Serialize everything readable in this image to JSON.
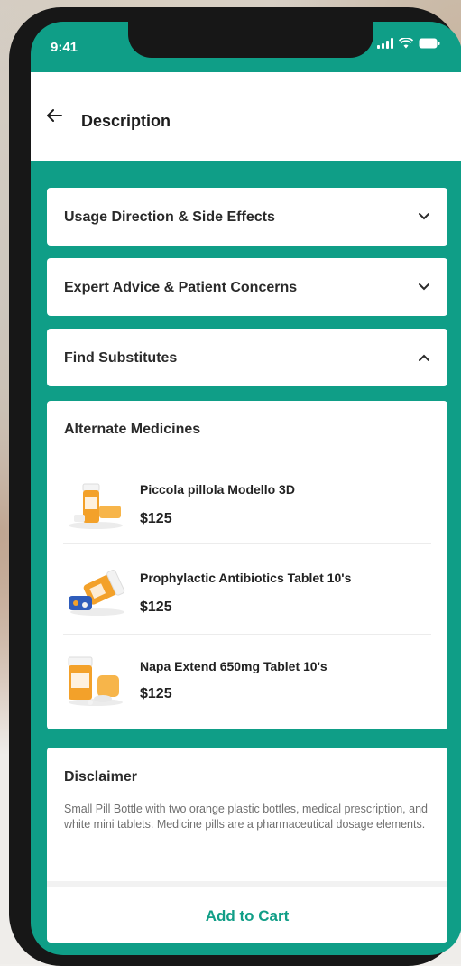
{
  "status": {
    "time": "9:41"
  },
  "header": {
    "title": "Description"
  },
  "accordions": [
    {
      "label": "Usage Direction & Side Effects",
      "state": "collapsed"
    },
    {
      "label": "Expert Advice & Patient Concerns",
      "state": "collapsed"
    },
    {
      "label": "Find Substitutes",
      "state": "expanded"
    }
  ],
  "alternates": {
    "heading": "Alternate Medicines",
    "items": [
      {
        "name": "Piccola pillola Modello 3D",
        "price": "$125"
      },
      {
        "name": "Prophylactic Antibiotics Tablet 10's",
        "price": "$125"
      },
      {
        "name": "Napa Extend 650mg Tablet 10's",
        "price": "$125"
      }
    ]
  },
  "disclaimer": {
    "heading": "Disclaimer",
    "text": "Small Pill Bottle with two orange plastic bottles, medical prescription, and white mini tablets. Medicine pills are a pharmaceutical dosage elements."
  },
  "cta": {
    "label": "Add to Cart"
  },
  "colors": {
    "accent": "#0f9e87",
    "card": "#ffffff",
    "frame": "#171717"
  },
  "icons": [
    "back-arrow-icon",
    "chevron-down-icon",
    "chevron-up-icon",
    "signal-icon",
    "wifi-icon",
    "battery-icon"
  ]
}
